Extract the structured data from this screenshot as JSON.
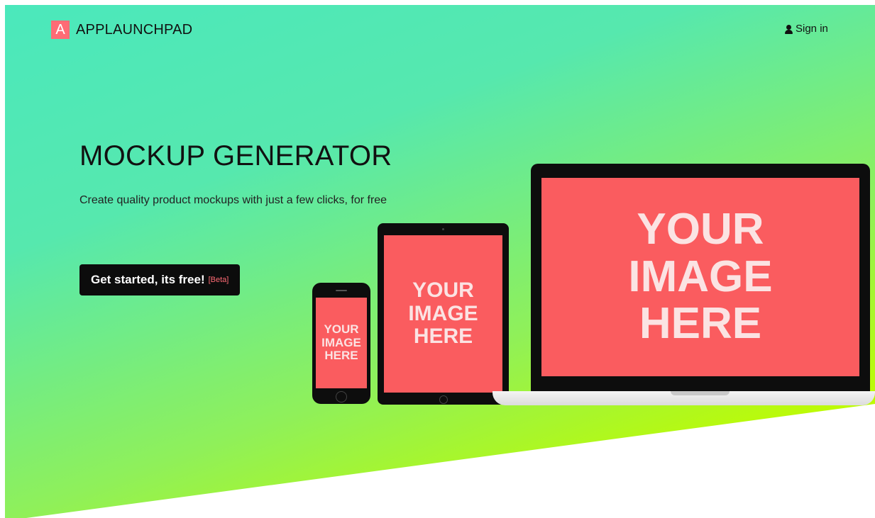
{
  "header": {
    "brand_mark": "A",
    "brand_name": "APPLAUNCHPAD",
    "signin_label": "Sign in",
    "signin_icon": "user-icon"
  },
  "hero": {
    "title": "MOCKUP GENERATOR",
    "subtitle": "Create quality product mockups with just a few clicks, for free",
    "cta_label": "Get started, its free!",
    "cta_badge": "[Beta]"
  },
  "devices": {
    "placeholder_lines": [
      "YOUR",
      "IMAGE",
      "HERE"
    ]
  },
  "colors": {
    "accent": "#ff6b75",
    "screen_fill": "#fa5c5f",
    "gradient_start": "#4be8bc",
    "gradient_end": "#c4fd00",
    "button_bg": "#0c0c0c"
  }
}
